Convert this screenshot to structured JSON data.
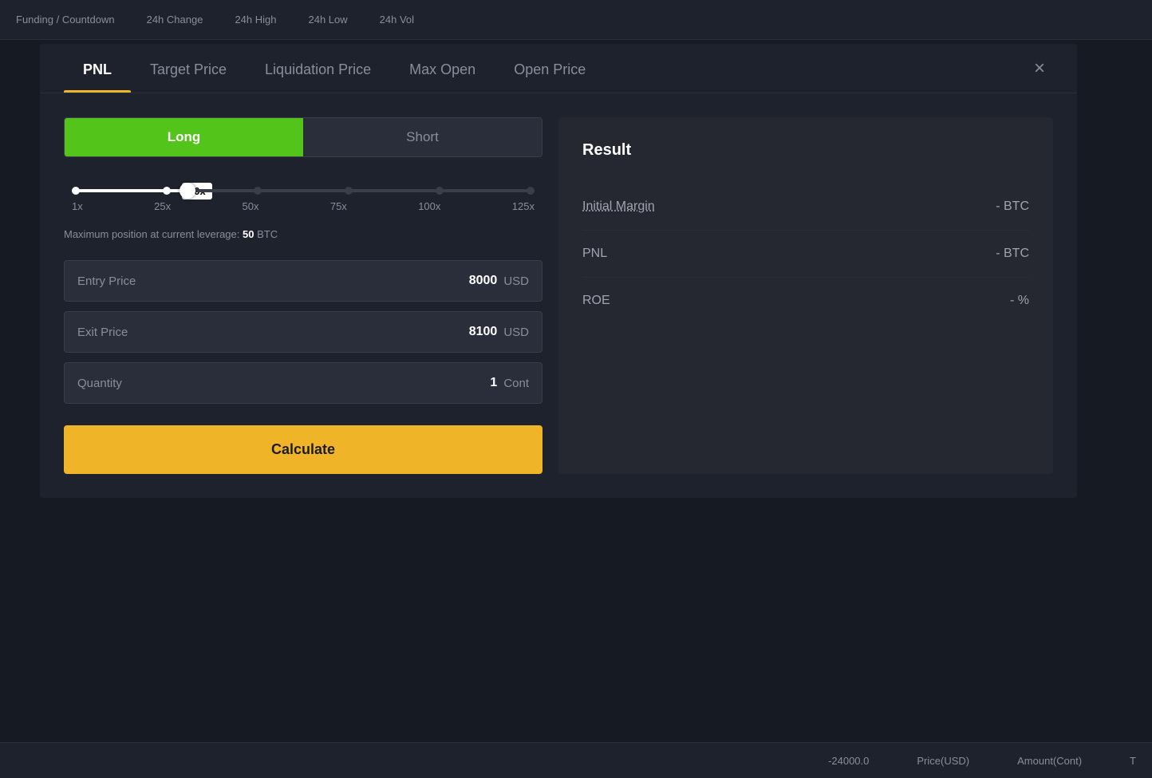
{
  "topBar": {
    "items": [
      "Funding / Countdown",
      "24h Change",
      "24h High",
      "24h Low",
      "24h Vol"
    ]
  },
  "bottomBar": {
    "items": [
      "-24000.0",
      "Price(USD)",
      "Amount(Cont)",
      "T"
    ]
  },
  "tabs": [
    {
      "label": "PNL",
      "active": true
    },
    {
      "label": "Target Price",
      "active": false
    },
    {
      "label": "Liquidation Price",
      "active": false
    },
    {
      "label": "Max Open",
      "active": false
    },
    {
      "label": "Open Price",
      "active": false
    }
  ],
  "closeButton": "×",
  "toggle": {
    "longLabel": "Long",
    "shortLabel": "Short"
  },
  "leverage": {
    "badge": "20x",
    "labels": [
      "1x",
      "25x",
      "50x",
      "75x",
      "100x",
      "125x"
    ],
    "maxPositionText": "Maximum position at current leverage:",
    "maxPositionValue": "50",
    "maxPositionUnit": "BTC"
  },
  "inputs": [
    {
      "label": "Entry Price",
      "value": "8000",
      "unit": "USD"
    },
    {
      "label": "Exit Price",
      "value": "8100",
      "unit": "USD"
    },
    {
      "label": "Quantity",
      "value": "1",
      "unit": "Cont"
    }
  ],
  "calculateButton": "Calculate",
  "result": {
    "title": "Result",
    "rows": [
      {
        "label": "Initial Margin",
        "value": "- BTC",
        "underline": true
      },
      {
        "label": "PNL",
        "value": "- BTC",
        "underline": false
      },
      {
        "label": "ROE",
        "value": "- %",
        "underline": false
      }
    ]
  }
}
